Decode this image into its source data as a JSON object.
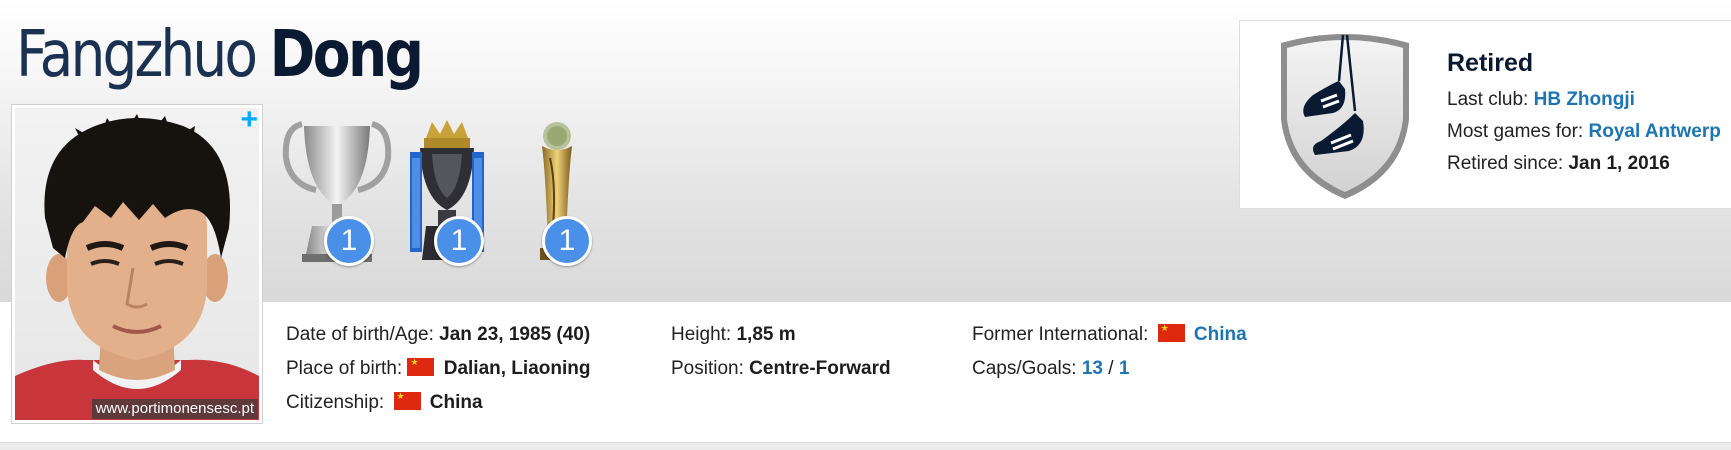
{
  "player": {
    "first_name": "Fangzhuo",
    "last_name": "Dong",
    "photo_plus": "+",
    "photo_credit": "www.portimonensesc.pt"
  },
  "trophies": [
    {
      "icon": "champions-league-trophy-icon",
      "count": "1"
    },
    {
      "icon": "premier-league-trophy-icon",
      "count": "1"
    },
    {
      "icon": "club-world-cup-trophy-icon",
      "count": "1"
    }
  ],
  "status": {
    "icon": "retired-boots-shield-icon",
    "title": "Retired",
    "last_club_label": "Last club:",
    "last_club": "HB Zhongji",
    "most_games_label": "Most games for:",
    "most_games": "Royal Antwerp",
    "retired_since_label": "Retired since:",
    "retired_since": "Jan 1, 2016"
  },
  "info": {
    "dob_label": "Date of birth/Age:",
    "dob": "Jan 23, 1985 (40)",
    "pob_label": "Place of birth:",
    "pob": "Dalian, Liaoning",
    "citizenship_label": "Citizenship:",
    "citizenship": "China",
    "height_label": "Height:",
    "height": "1,85 m",
    "position_label": "Position:",
    "position": "Centre-Forward",
    "intl_label": "Former International:",
    "intl": "China",
    "caps_label": "Caps/Goals:",
    "caps": "13",
    "caps_sep": "/",
    "goals": "1"
  },
  "colors": {
    "link": "#1d75b3",
    "badge": "#4a90e8",
    "heading": "#0b1a33",
    "plus": "#00aaff"
  }
}
